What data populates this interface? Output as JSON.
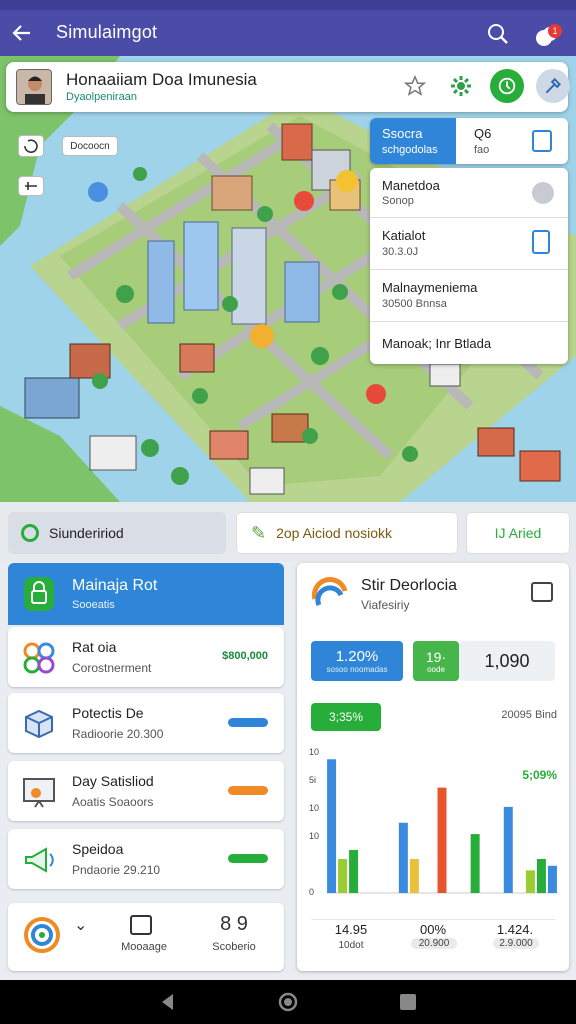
{
  "appbar": {
    "title": "Simulaimgot",
    "badge": "1"
  },
  "location_card": {
    "name": "Honaaiiam Doa Imunesia",
    "subtitle": "Dyaolpeniraan"
  },
  "map_controls": {
    "tag": "Docoocn"
  },
  "popup": {
    "blue_title": "Ssocra",
    "blue_sub": "schgodolas",
    "num": "Q6",
    "num_sub": "fao",
    "items": [
      {
        "title": "Manetdoa",
        "sub": "Sonop"
      },
      {
        "title": "Katialot",
        "sub": "30.3.0J"
      },
      {
        "title": "Malnaymeniema",
        "sub": "30500 Bnnsa"
      },
      {
        "title": "Manoak; Inr Btlada",
        "sub": ""
      }
    ]
  },
  "chips": {
    "c1": "Siundeririod",
    "c2": "2op Aiciod nosiokk",
    "c3": "IJ Aried"
  },
  "left_panel": {
    "head_title": "Mainaja Rot",
    "head_sub": "Sooeatis",
    "rows": [
      {
        "title": "Rat oia",
        "sub": "Corostnerment",
        "value": "$800,000"
      },
      {
        "title": "Potectis De",
        "sub": "Radioorie 20.300",
        "value": ""
      },
      {
        "title": "Day Satisliod",
        "sub": "Aoatis Soaoors",
        "value": ""
      },
      {
        "title": "Speidoa",
        "sub": "Pndaorie 29.210",
        "value": ""
      }
    ]
  },
  "bottom_nav": {
    "mid_label": "Mooaage",
    "right_num": "8 9",
    "right_label": "Scoberio"
  },
  "right_panel": {
    "title": "Stir Deorlocia",
    "subtitle": "Viafesiriy",
    "stat1": "1.20%",
    "stat1_sub": "sosoo noomadas",
    "stat2": "19·",
    "stat2_sub": "oode",
    "stat3": "1,090",
    "green_pill": "3;35%",
    "right_note": "20095 Bind",
    "green_pct": "5;09%",
    "yticks": [
      "10",
      "5i",
      "10",
      "10",
      "0"
    ],
    "foot": [
      {
        "v": "14.95",
        "s": "10dot"
      },
      {
        "v": "00%",
        "s": "20.900"
      },
      {
        "v": "1.424.",
        "s": "2.9.000"
      }
    ]
  },
  "chart_data": {
    "type": "bar",
    "categories": [
      "1",
      "2",
      "3",
      "4",
      "5",
      "6",
      "7"
    ],
    "ylim": [
      0,
      120
    ],
    "series": [
      {
        "color": "#3a8be0",
        "values": [
          118,
          0,
          62,
          0,
          0,
          76,
          0
        ]
      },
      {
        "color": "#9acd32",
        "values": [
          30,
          0,
          0,
          0,
          0,
          0,
          20
        ]
      },
      {
        "color": "#27ae3a",
        "values": [
          38,
          0,
          0,
          0,
          52,
          0,
          30
        ]
      },
      {
        "color": "#e8542c",
        "values": [
          0,
          0,
          0,
          93,
          0,
          0,
          0
        ]
      },
      {
        "color": "#e9c23a",
        "values": [
          0,
          0,
          30,
          0,
          0,
          0,
          0
        ]
      },
      {
        "color": "#3a8be0",
        "values": [
          0,
          0,
          0,
          0,
          0,
          0,
          24
        ]
      }
    ]
  },
  "colors": {
    "primary": "#4a4ca8",
    "accent_blue": "#2f86d8",
    "green": "#27ae3a",
    "orange": "#f08a24"
  }
}
